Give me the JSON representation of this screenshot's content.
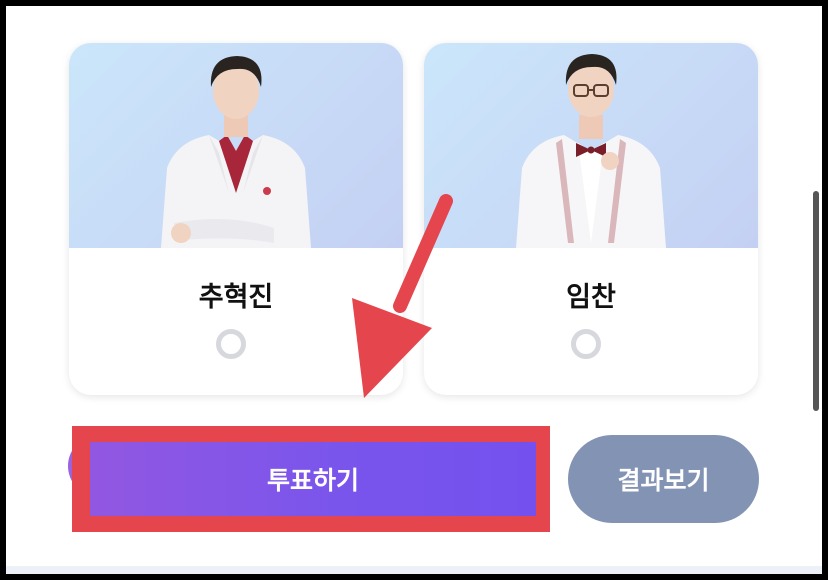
{
  "candidates": [
    {
      "name": "추혁진",
      "selected": false
    },
    {
      "name": "임찬",
      "selected": false
    }
  ],
  "actions": {
    "vote_label": "투표하기",
    "results_label": "결과보기"
  },
  "colors": {
    "vote_gradient": [
      "#9257e1",
      "#7451ee"
    ],
    "results_bg": "#8393b4",
    "highlight": "#e5454d",
    "arrow": "#e5454d"
  }
}
